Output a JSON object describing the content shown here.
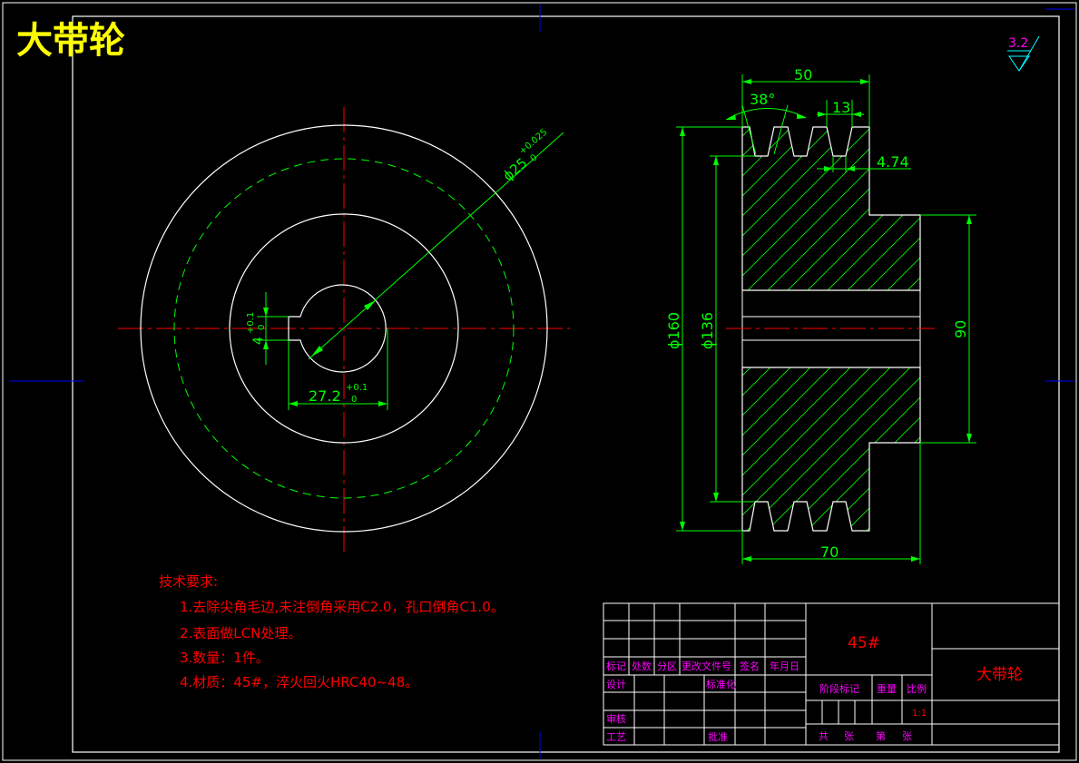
{
  "drawing": {
    "title": "大带轮",
    "roughness": "3.2"
  },
  "front_view": {
    "bore_dim": "ϕ25",
    "bore_tol_upper": "+0.025",
    "bore_tol_lower": "0",
    "key_depth_dim": "4",
    "key_depth_tol_upper": "+0.1",
    "key_depth_tol_lower": "0",
    "hub_dim": "27.2",
    "hub_tol_upper": "+0.1",
    "hub_tol_lower": "0"
  },
  "section_view": {
    "groove_span": "50",
    "groove_angle": "38°",
    "groove_pitch": "13",
    "groove_depth": "4.74",
    "outer_diameter": "ϕ160",
    "pitch_diameter": "ϕ136",
    "hub_diameter": "90",
    "total_width": "70"
  },
  "requirements": {
    "heading": "技术要求:",
    "items": [
      "1.去除尖角毛边,未注倒角采用C2.0，孔口倒角C1.0。",
      "2.表面做LCN处理。",
      "3.数量：1件。",
      "4.材质：45#，淬火回火HRC40~48。"
    ]
  },
  "title_block": {
    "material": "45#",
    "part_name": "大带轮",
    "col_biaoji": "标记",
    "col_chushu": "处数",
    "col_fenqu": "分区",
    "col_genggai": "更改文件号",
    "col_qianming": "签名",
    "col_nianyueri": "年月日",
    "design": "设计",
    "standard": "标准化",
    "stage_mark": "阶段标记",
    "weight": "重量",
    "scale_label": "比例",
    "scale_value": "1:1",
    "review": "审核",
    "process": "工艺",
    "approve": "批准",
    "gong": "共",
    "zhang": "张",
    "di": "第",
    "zhang2": "张"
  }
}
